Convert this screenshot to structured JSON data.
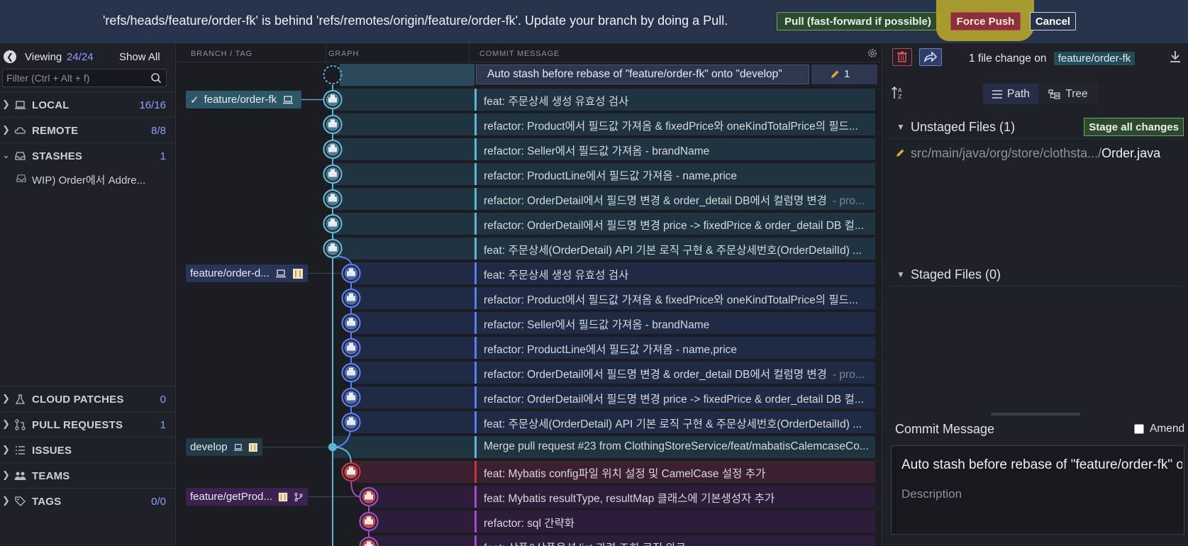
{
  "banner": {
    "message": "'refs/heads/feature/order-fk' is behind 'refs/remotes/origin/feature/order-fk'. Update your branch by doing a Pull.",
    "pull_label": "Pull (fast-forward if possible)",
    "force_push_label": "Force Push",
    "cancel_label": "Cancel"
  },
  "sidebar": {
    "viewing_label": "Viewing",
    "viewing_count": "24/24",
    "show_all_label": "Show All",
    "filter_placeholder": "Filter (Ctrl + Alt + f)",
    "sections": [
      {
        "name": "LOCAL",
        "count": "16/16",
        "icon": "laptop-icon",
        "expanded": false
      },
      {
        "name": "REMOTE",
        "count": "8/8",
        "icon": "cloud-icon",
        "expanded": false
      },
      {
        "name": "STASHES",
        "count": "1",
        "icon": "inbox-icon",
        "expanded": true
      },
      {
        "name": "CLOUD PATCHES",
        "count": "0",
        "icon": "flask-icon",
        "expanded": false
      },
      {
        "name": "PULL REQUESTS",
        "count": "1",
        "icon": "pull-request-icon",
        "expanded": false
      },
      {
        "name": "ISSUES",
        "count": "",
        "icon": "list-icon",
        "expanded": false
      },
      {
        "name": "TEAMS",
        "count": "",
        "icon": "people-icon",
        "expanded": false
      },
      {
        "name": "TAGS",
        "count": "0/0",
        "icon": "tag-icon",
        "expanded": false
      }
    ],
    "stash_item": "WIP) Order에서 Addre..."
  },
  "graph": {
    "headers": {
      "branch": "BRANCH / TAG",
      "graph": "GRAPH",
      "message": "COMMIT MESSAGE"
    },
    "stash_row": {
      "message": "Auto stash before rebase of \"feature/order-fk\" onto \"develop\"",
      "count": "1"
    },
    "refs": {
      "order_fk": "feature/order-fk",
      "order_d": "feature/order-d...",
      "develop": "develop",
      "get_prod": "feature/getProd..."
    },
    "commits": [
      {
        "message": "feat: 주문상세 생성 유효성 검사",
        "sub": ""
      },
      {
        "message": "refactor: Product에서 필드값 가져옴 & fixedPrice와 oneKindTotalPrice의 필드...",
        "sub": ""
      },
      {
        "message": "refactor: Seller에서 필드값 가져옴 - brandName",
        "sub": ""
      },
      {
        "message": "refactor: ProductLine에서 필드값 가져옴 - name,price",
        "sub": ""
      },
      {
        "message": "refactor: OrderDetail에서 필드명 변경 & order_detail DB에서 컬럼명 변경",
        "sub": "- pro..."
      },
      {
        "message": "refactor: OrderDetail에서 필드명 변경 price -> fixedPrice & order_detail DB 컬...",
        "sub": ""
      },
      {
        "message": "feat: 주문상세(OrderDetail) API 기본 로직 구현 & 주문상세번호(OrderDetailId) ...",
        "sub": ""
      },
      {
        "message": "feat: 주문상세 생성 유효성 검사",
        "sub": ""
      },
      {
        "message": "refactor: Product에서 필드값 가져옴 & fixedPrice와 oneKindTotalPrice의 필드...",
        "sub": ""
      },
      {
        "message": "refactor: Seller에서 필드값 가져옴 - brandName",
        "sub": ""
      },
      {
        "message": "refactor: ProductLine에서 필드값 가져옴 - name,price",
        "sub": ""
      },
      {
        "message": "refactor: OrderDetail에서 필드명 변경 & order_detail DB에서 컬럼명 변경",
        "sub": "- pro..."
      },
      {
        "message": "refactor: OrderDetail에서 필드명 변경 price -> fixedPrice & order_detail DB 컬...",
        "sub": ""
      },
      {
        "message": "feat: 주문상세(OrderDetail) API 기본 로직 구현 & 주문상세번호(OrderDetailId) ...",
        "sub": ""
      },
      {
        "message": "Merge pull request #23 from ClothingStoreService/feat/mabatisCalemcaseCo...",
        "sub": ""
      },
      {
        "message": "feat: Mybatis config파일 위치 설정 및 CamelCase 설정 추가",
        "sub": ""
      },
      {
        "message": "feat: Mybatis resultType, resultMap 클래스에 기본생성자 추가",
        "sub": ""
      },
      {
        "message": "refactor: sql 간략화",
        "sub": ""
      },
      {
        "message": "feat: 상품&상품옵션 list 관련 조회 로직 완료",
        "sub": ""
      }
    ]
  },
  "right": {
    "file_change_text": "1 file change on",
    "branch": "feature/order-fk",
    "path_label": "Path",
    "tree_label": "Tree",
    "unstaged_label": "Unstaged Files (1)",
    "stage_all_label": "Stage all changes",
    "file_dir": "src/main/java/org/store/clothsta.../",
    "file_name": "Order.java",
    "staged_label": "Staged Files (0)",
    "commit_message_label": "Commit Message",
    "amend_label": "Amend",
    "summary": "Auto stash before rebase of \"feature/order-fk\" onto \"develop\"",
    "description_placeholder": "Description"
  },
  "colors": {
    "teal_lane": "#5fb5d6",
    "blue_lane": "#5b7cf4",
    "purple_lane": "#a04cc4",
    "red_lane": "#c9353d",
    "force_push": "#8e3038",
    "stage_green": "#6ea564",
    "highlight": "#b9a92a"
  }
}
